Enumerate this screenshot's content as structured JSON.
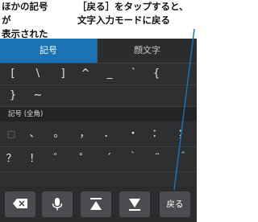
{
  "callouts": {
    "left_line1": "ほかの記号が",
    "left_line2": "表示された",
    "right_line1": "［戻る］をタップすると、",
    "right_line2": "文字入力モードに戻る"
  },
  "tabs": {
    "symbols": "記号",
    "emoticons": "顔文字"
  },
  "rows": {
    "row1": [
      "[",
      "\\",
      "]",
      "^",
      "_",
      "`",
      "{"
    ],
    "row2": [
      "}",
      "~"
    ],
    "section_label": "記号 (全角)",
    "row3": [
      "□",
      "、",
      "。",
      "，",
      "．",
      "・",
      "：",
      "；"
    ],
    "row4": [
      "？",
      "！",
      "゛",
      "゜",
      "´",
      "｀",
      "¨",
      "＾"
    ]
  },
  "toolbar": {
    "back_label": "戻る",
    "delete_icon": "backspace-icon",
    "mic_icon": "microphone-icon",
    "up_icon": "scroll-to-top-icon",
    "down_icon": "scroll-to-bottom-icon"
  },
  "colors": {
    "accent": "#1b72b5",
    "keyboard_bg": "#2d2f31",
    "pointer": "#1b72b5"
  }
}
